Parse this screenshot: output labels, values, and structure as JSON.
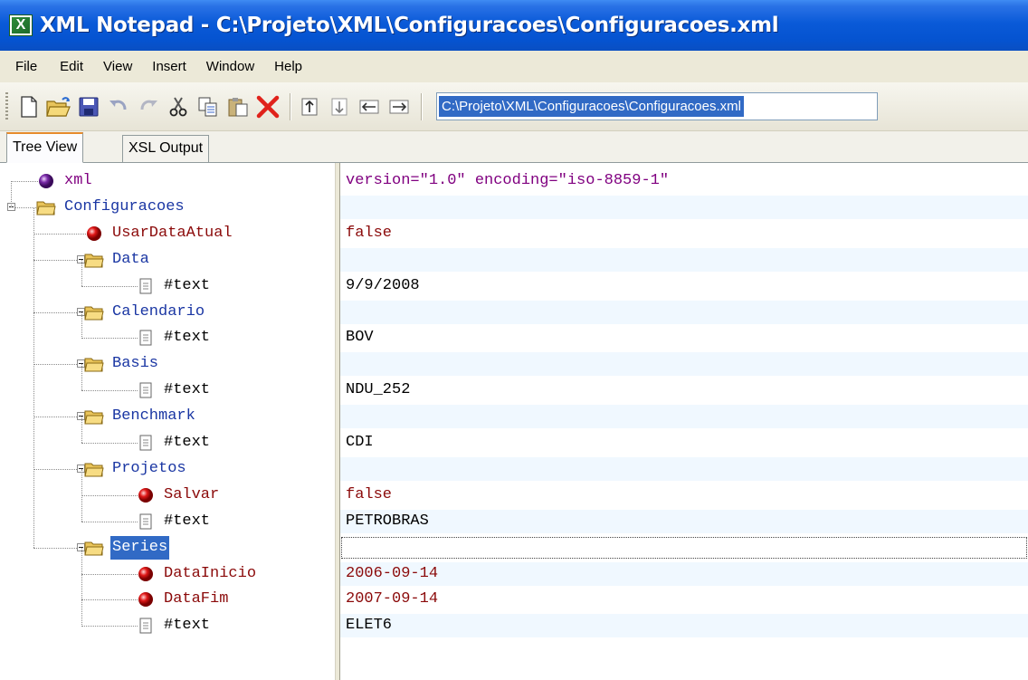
{
  "window": {
    "title": "XML Notepad - C:\\Projeto\\XML\\Configuracoes\\Configuracoes.xml",
    "app_icon_letter": "X"
  },
  "menu": [
    "File",
    "Edit",
    "View",
    "Insert",
    "Window",
    "Help"
  ],
  "toolbar": {
    "buttons": [
      "new-icon",
      "open-icon",
      "save-icon",
      "undo-icon",
      "redo-icon",
      "cut-icon",
      "copy-icon",
      "paste-icon",
      "delete-icon",
      "nudge-up-icon",
      "nudge-down-icon",
      "nudge-left-icon",
      "nudge-right-icon"
    ],
    "path": "C:\\Projeto\\XML\\Configuracoes\\Configuracoes.xml"
  },
  "tabs": [
    "Tree View",
    "XSL Output"
  ],
  "tree": [
    {
      "label": "xml",
      "type": "pi",
      "value": "version=\"1.0\" encoding=\"iso-8859-1\""
    },
    {
      "label": "Configuracoes",
      "type": "element",
      "value": ""
    },
    {
      "label": "UsarDataAtual",
      "type": "attribute",
      "value": "false"
    },
    {
      "label": "Data",
      "type": "element",
      "value": ""
    },
    {
      "label": "#text",
      "type": "text",
      "value": "9/9/2008"
    },
    {
      "label": "Calendario",
      "type": "element",
      "value": ""
    },
    {
      "label": "#text",
      "type": "text",
      "value": "BOV"
    },
    {
      "label": "Basis",
      "type": "element",
      "value": ""
    },
    {
      "label": "#text",
      "type": "text",
      "value": "NDU_252"
    },
    {
      "label": "Benchmark",
      "type": "element",
      "value": ""
    },
    {
      "label": "#text",
      "type": "text",
      "value": "CDI"
    },
    {
      "label": "Projetos",
      "type": "element",
      "value": ""
    },
    {
      "label": "Salvar",
      "type": "attribute",
      "value": "false"
    },
    {
      "label": "#text",
      "type": "text",
      "value": "PETROBRAS"
    },
    {
      "label": "Series",
      "type": "element",
      "value": ""
    },
    {
      "label": "DataInicio",
      "type": "attribute",
      "value": "2006-09-14"
    },
    {
      "label": "DataFim",
      "type": "attribute",
      "value": "2007-09-14"
    },
    {
      "label": "#text",
      "type": "text",
      "value": "ELET6"
    }
  ],
  "selected_node": "Series",
  "colors": {
    "titlebar": "#0553d0",
    "selection": "#316ac5",
    "element_text": "#1a36a3",
    "attribute_text": "#8b0a0a",
    "pi_text": "#800080",
    "alt_row": "#f0f8ff"
  }
}
